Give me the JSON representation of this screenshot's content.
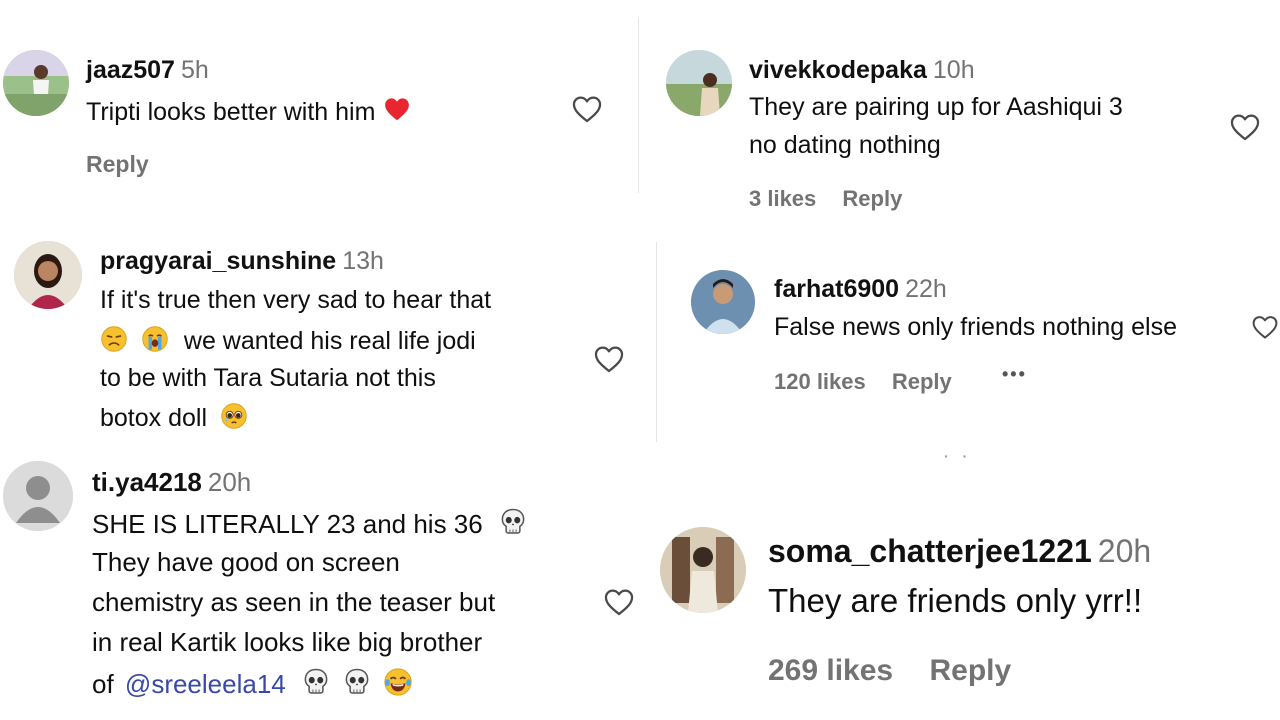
{
  "comments": [
    {
      "username": "jaaz507",
      "time": "5h",
      "lines": [
        "Tripti looks better with him"
      ],
      "likes": "",
      "reply": "Reply"
    },
    {
      "username": "vivekkodepaka",
      "time": "10h",
      "lines": [
        "They are pairing up for Aashiqui 3",
        "no dating nothing"
      ],
      "likes": "3 likes",
      "reply": "Reply"
    },
    {
      "username": "pragyarai_sunshine",
      "time": "13h",
      "lines": [
        "If it's true then very sad to hear that",
        "we wanted his real life jodi",
        "to be with Tara Sutaria not this",
        "botox doll"
      ],
      "likes": "",
      "reply": ""
    },
    {
      "username": "farhat6900",
      "time": "22h",
      "lines": [
        "False news only friends nothing else"
      ],
      "likes": "120 likes",
      "reply": "Reply",
      "more": "•••"
    },
    {
      "username": "ti.ya4218",
      "time": "20h",
      "lines": [
        "SHE IS LITERALLY 23 and his 36",
        "They have good on screen",
        "chemistry as seen in the teaser but",
        "in real Kartik looks like big brother",
        "of"
      ],
      "mention": "@sreeleela14",
      "likes": "",
      "reply": ""
    },
    {
      "username": "soma_chatterjee1221",
      "time": "20h",
      "lines": [
        "They are friends only yrr!!"
      ],
      "likes": "269 likes",
      "reply": "Reply"
    }
  ],
  "icons": {
    "like": "heart-outline-icon",
    "red_heart": "red-heart-emoji",
    "skull": "skull-emoji",
    "sad": "unamused-face-emoji",
    "crying": "loudly-crying-emoji",
    "pleading": "pleading-face-emoji",
    "laughing": "tears-of-joy-emoji",
    "default_avatar": "default-avatar-icon"
  },
  "colors": {
    "username": "#111111",
    "meta": "#737373",
    "mention": "#3949a8",
    "heart_emoji": "#e8262f"
  }
}
